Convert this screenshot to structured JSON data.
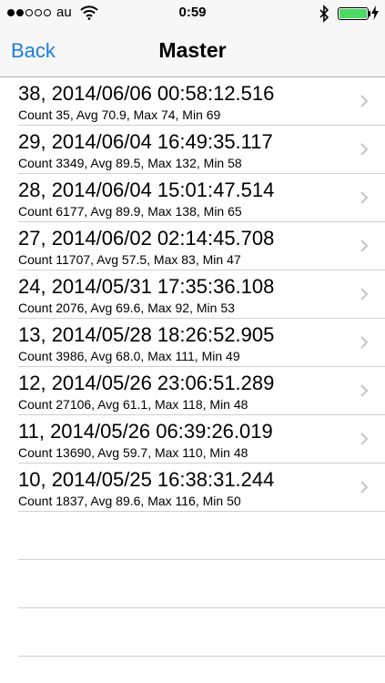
{
  "status": {
    "carrier": "au",
    "time": "0:59",
    "signal_bars": 2,
    "battery_color": "#4cd964"
  },
  "nav": {
    "back_label": "Back",
    "title": "Master"
  },
  "rows": [
    {
      "title": "38, 2014/06/06 00:58:12.516",
      "detail": "Count 35, Avg 70.9, Max 74, Min 69"
    },
    {
      "title": "29, 2014/06/04 16:49:35.117",
      "detail": "Count 3349, Avg 89.5, Max 132, Min 58"
    },
    {
      "title": "28, 2014/06/04 15:01:47.514",
      "detail": "Count 6177, Avg 89.9, Max 138, Min 65"
    },
    {
      "title": "27, 2014/06/02 02:14:45.708",
      "detail": "Count 11707, Avg 57.5, Max 83, Min 47"
    },
    {
      "title": "24, 2014/05/31 17:35:36.108",
      "detail": "Count 2076, Avg 69.6, Max 92, Min 53"
    },
    {
      "title": "13, 2014/05/28 18:26:52.905",
      "detail": "Count 3986, Avg 68.0, Max 111, Min 49"
    },
    {
      "title": "12, 2014/05/26 23:06:51.289",
      "detail": "Count 27106, Avg 61.1, Max 118, Min 48"
    },
    {
      "title": "11, 2014/05/26 06:39:26.019",
      "detail": "Count 13690, Avg 59.7, Max 110, Min 48"
    },
    {
      "title": "10, 2014/05/25 16:38:31.244",
      "detail": "Count 1837, Avg 89.6, Max 116, Min 50"
    }
  ],
  "icons": {
    "wifi": "wifi-icon",
    "bluetooth": "bluetooth-icon",
    "battery": "battery-icon",
    "charging": "charging-bolt-icon",
    "disclosure": "chevron-right-icon"
  },
  "accent_color": "#1a7ee0"
}
